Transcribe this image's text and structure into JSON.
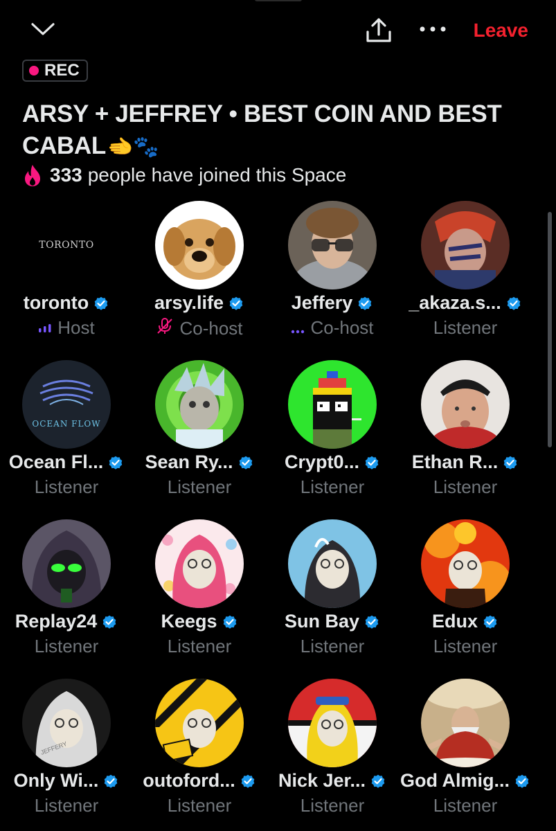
{
  "header": {
    "leave_label": "Leave",
    "icons": [
      "chevron-down-icon",
      "share-icon",
      "more-icon"
    ]
  },
  "rec_label": "REC",
  "space": {
    "title": "ARSY + JEFFREY • BEST COIN AND BEST CABAL",
    "title_emoji": "🫲🐾",
    "joined_count": "333",
    "joined_text": "people have joined this Space"
  },
  "colors": {
    "accent_red": "#f4212e",
    "verified_blue": "#1d9bf0",
    "rec_pink": "#f91880",
    "role_purple": "#7856ff"
  },
  "participants": [
    {
      "name": "toronto",
      "role": "Host",
      "role_icon": "speaking-icon",
      "avatar": "toronto-logo"
    },
    {
      "name": "arsy.life",
      "role": "Co-host",
      "role_icon": "mic-muted-icon",
      "avatar": "golden-retriever"
    },
    {
      "name": "Jeffery",
      "role": "Co-host",
      "role_icon": "listening-dots-icon",
      "avatar": "man-glasses-hoodie"
    },
    {
      "name": "_akaza.s...",
      "role": "Listener",
      "avatar": "anime-character"
    },
    {
      "name": "Ocean Fl...",
      "role": "Listener",
      "avatar": "ocean-flow-logo"
    },
    {
      "name": "Sean Ry...",
      "role": "Listener",
      "avatar": "ape-rick"
    },
    {
      "name": "Crypt0...",
      "role": "Listener",
      "avatar": "pixel-propeller-hat"
    },
    {
      "name": "Ethan R...",
      "role": "Listener",
      "avatar": "man-backwards-cap"
    },
    {
      "name": "Replay24",
      "role": "Listener",
      "avatar": "hooded-green-goggles"
    },
    {
      "name": "Keegs",
      "role": "Listener",
      "avatar": "pink-hoodie-cupcakes"
    },
    {
      "name": "Sun Bay",
      "role": "Listener",
      "avatar": "blue-bg-character"
    },
    {
      "name": "Edux",
      "role": "Listener",
      "avatar": "fire-bg-character"
    },
    {
      "name": "Only Wi...",
      "role": "Listener",
      "avatar": "jeffery-hoodie"
    },
    {
      "name": "outoford...",
      "role": "Listener",
      "avatar": "out-of-order-stripes"
    },
    {
      "name": "Nick Jer...",
      "role": "Listener",
      "avatar": "pokemon-hoodie"
    },
    {
      "name": "God Almig...",
      "role": "Listener",
      "avatar": "god-painting"
    }
  ]
}
